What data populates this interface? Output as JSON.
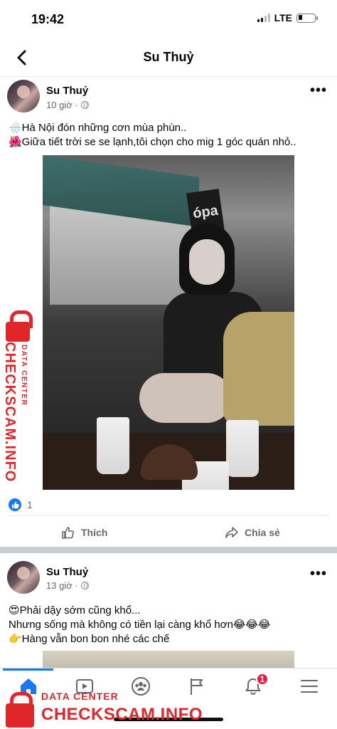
{
  "status_bar": {
    "time": "19:42",
    "network": "LTE",
    "signal_bars": 2,
    "battery_level": 0.2
  },
  "header": {
    "title": "Su Thuỷ",
    "back_icon": "chevron-left-icon"
  },
  "posts": [
    {
      "author": "Su Thuỷ",
      "time": "10 giờ ·",
      "lines": [
        "🌧️Hà Nội đón những cơn mùa phùn..",
        "🌺Giữa tiết trời se se lạnh,tôi chọn cho mig 1 góc quán nhỏ.."
      ],
      "photo_sign": "ópa",
      "reaction_count": "1",
      "like_label": "Thích",
      "share_label": "Chia sẻ"
    },
    {
      "author": "Su Thuỷ",
      "time": "13 giờ ·",
      "lines": [
        "😍Phải dậy sớm cũng khổ...",
        "Nhưng sống mà không có tiền lại càng khổ hơn😂😂😂",
        "👉Hàng vẫn bon bon nhé các chế"
      ]
    }
  ],
  "tabbar": {
    "tabs": [
      "home-icon",
      "video-icon",
      "groups-icon",
      "flag-icon",
      "bell-icon",
      "menu-icon"
    ],
    "active": "home-icon",
    "notification_count": "1",
    "accent": "#1877f2",
    "badge_color": "#e41e3f"
  },
  "watermark": {
    "small": "DATA CENTER",
    "big": "CHECKSCAM.INFO",
    "color": "#e0262b"
  }
}
